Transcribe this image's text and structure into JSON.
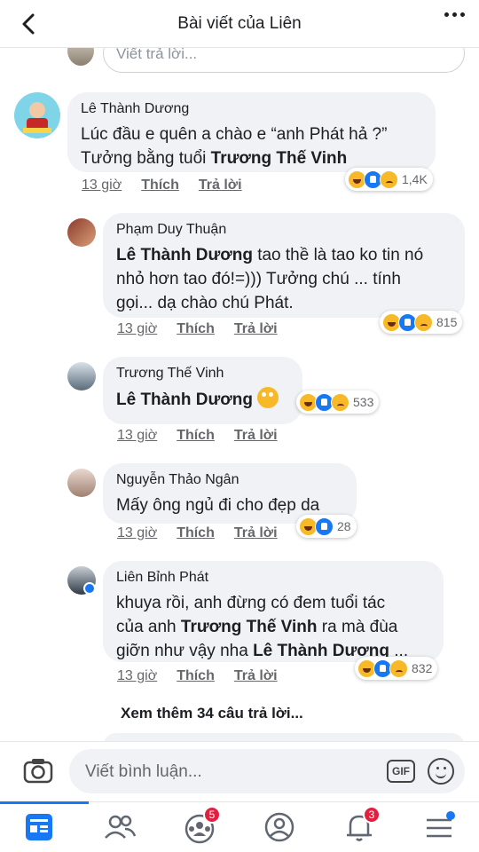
{
  "header": {
    "title": "Bài viết của Liên"
  },
  "top_reply_placeholder": "Viết trả lời...",
  "comments": [
    {
      "author": "Lê Thành Dương",
      "line1": "Lúc đầu e quên a chào e “anh Phát hả ?”",
      "line2_prefix": "Tưởng bằng tuổi ",
      "line2_tag": "Trương Thế Vinh",
      "time": "13 giờ",
      "like": "Thích",
      "reply": "Trả lời",
      "reaction_count": "1,4K"
    },
    {
      "author": "Phạm Duy Thuận",
      "tag": "Lê Thành Dương",
      "text_after_tag": " tao thề là tao ko tin nó",
      "line2": "nhỏ hơn tao đó!=))) Tưởng chú ... tính",
      "line3": "gọi... dạ chào chú Phát.",
      "time": "13 giờ",
      "like": "Thích",
      "reply": "Trả lời",
      "reaction_count": "815"
    },
    {
      "author": "Trương Thế Vinh",
      "tag": "Lê Thành Dương",
      "time": "13 giờ",
      "like": "Thích",
      "reply": "Trả lời",
      "reaction_count": "533"
    },
    {
      "author": "Nguyễn Thảo Ngân",
      "text": "Mấy ông ngủ đi cho đẹp da",
      "time": "13 giờ",
      "like": "Thích",
      "reply": "Trả lời",
      "reaction_count": "28"
    },
    {
      "author": "Liên Bỉnh Phát",
      "line1": "khuya rồi, anh đừng có đem tuổi tác",
      "line2_prefix": "của anh ",
      "line2_tag": "Trương Thế Vinh",
      "line2_suffix": " ra mà đùa",
      "line3_prefix": "giỡn như vậy nha ",
      "line3_tag": "Lê Thành Dương",
      "line3_suffix": " ...",
      "time": "13 giờ",
      "like": "Thích",
      "reply": "Trả lời",
      "reaction_count": "832"
    }
  ],
  "view_more": "Xem thêm 34 câu trả lời...",
  "composer": {
    "placeholder": "Viết bình luận...",
    "gif_label": "GIF"
  },
  "tabbar": {
    "tabs": [
      {
        "icon": "news-feed-icon",
        "active": true
      },
      {
        "icon": "friends-icon"
      },
      {
        "icon": "groups-icon",
        "badge": "5"
      },
      {
        "icon": "profile-icon"
      },
      {
        "icon": "notifications-bell-icon",
        "badge": "3"
      },
      {
        "icon": "menu-icon"
      }
    ]
  },
  "colors": {
    "accent": "#1877f2",
    "bubble": "#f0f2f5",
    "badge": "#e41e3f"
  }
}
